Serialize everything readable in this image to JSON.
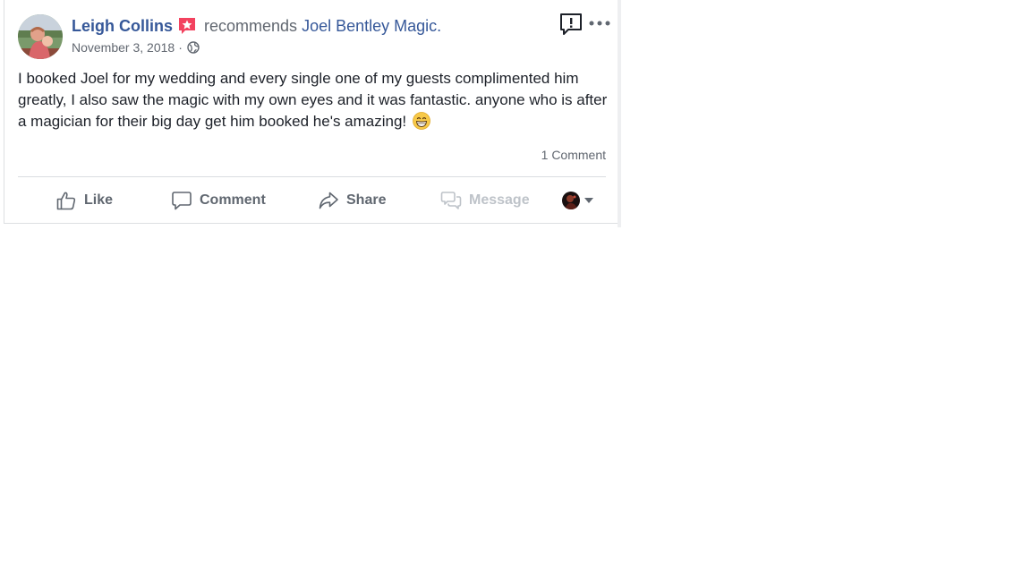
{
  "post": {
    "author": "Leigh Collins",
    "verb": "recommends",
    "page_name": "Joel Bentley Magic.",
    "date": "November 3, 2018",
    "separator": "·",
    "privacy_icon": "globe-icon",
    "badge_icon": "recommendation-star-icon",
    "text": "I booked Joel for my wedding and every single one of my guests complimented him greatly, I also saw the magic with my own eyes and it was fantastic. anyone who is after a magician for their big day get him booked he's amazing!",
    "emoji_icon": "grinning-face-emoji",
    "comment_count": "1 Comment"
  },
  "header_actions": {
    "report_icon": "report-exclamation-icon",
    "more_icon": "more-options-icon"
  },
  "actions": {
    "like": "Like",
    "comment": "Comment",
    "share": "Share",
    "message": "Message"
  },
  "colors": {
    "link": "#365899",
    "meta": "#616770",
    "text": "#1d2129",
    "action": "#606770",
    "disabled": "#bec3c9",
    "badge": "#f3425f"
  }
}
